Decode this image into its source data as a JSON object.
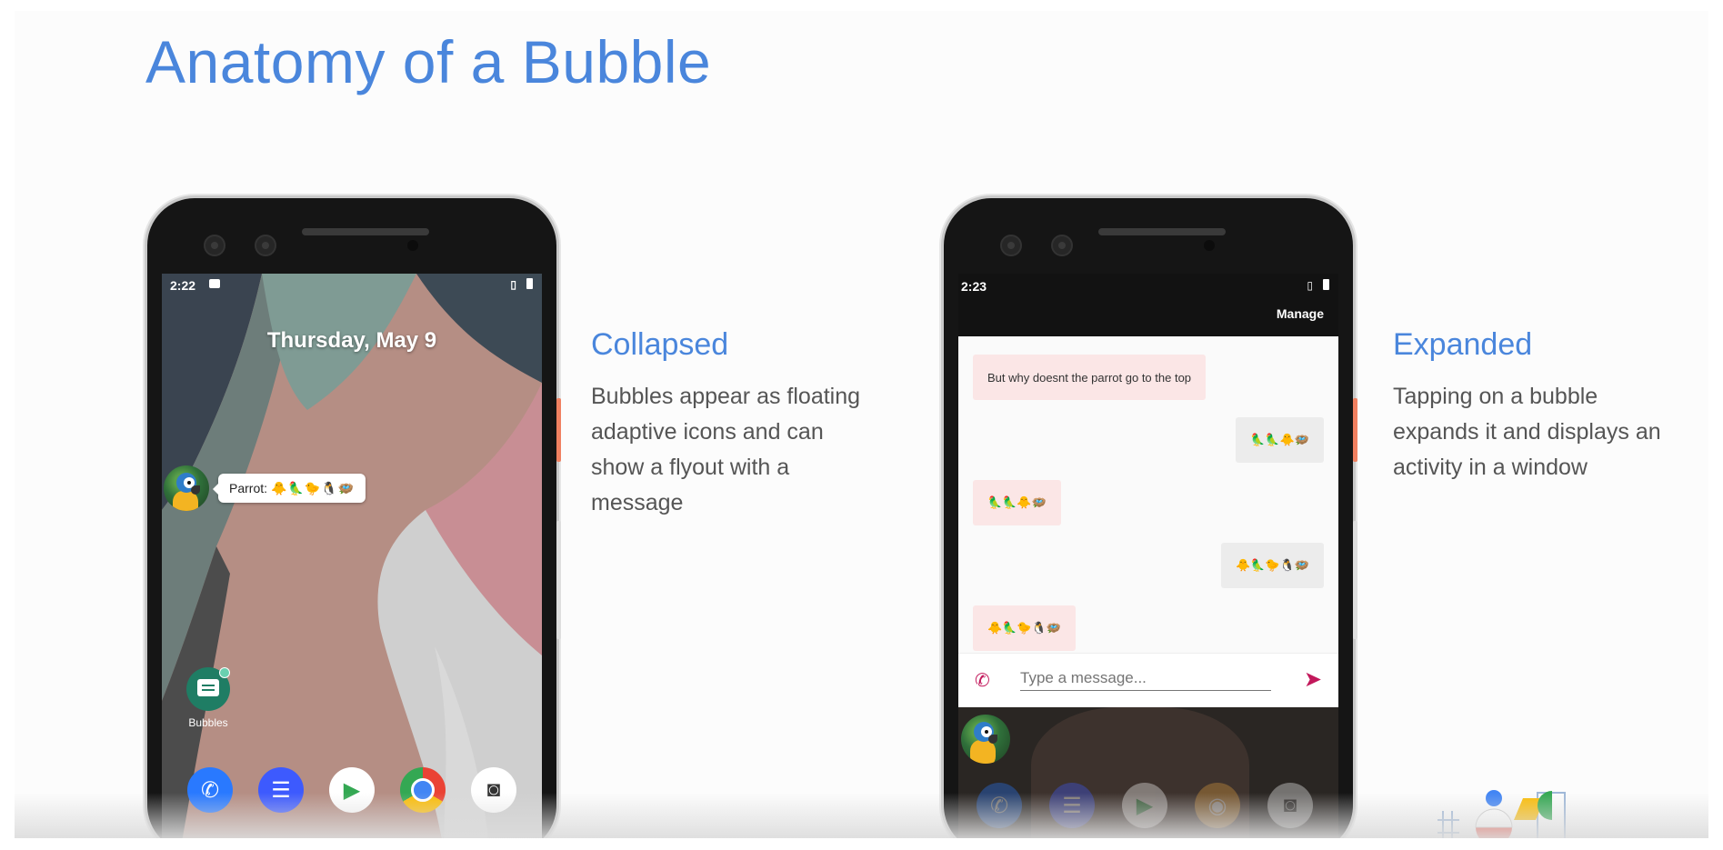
{
  "slide": {
    "title": "Anatomy of a Bubble"
  },
  "collapsed": {
    "heading": "Collapsed",
    "description": "Bubbles appear as floating adaptive icons and can show a flyout with a message"
  },
  "expanded": {
    "heading": "Expanded",
    "description": "Tapping on a bubble expands it and displays an activity in a window"
  },
  "left_phone": {
    "status_time": "2:22",
    "date": "Thursday, May 9",
    "flyout_sender": "Parrot:",
    "flyout_emojis": "🐥🦜🐤🐧🪺",
    "app_label": "Bubbles",
    "dock": [
      {
        "name": "phone-app-icon",
        "glyph": "📞",
        "color": "#2979ff"
      },
      {
        "name": "messages-app-icon",
        "glyph": "☰",
        "color": "#3d5afe"
      },
      {
        "name": "play-store-icon",
        "glyph": "▶",
        "color": "#ffffff"
      },
      {
        "name": "chrome-icon",
        "glyph": "◉",
        "color": "#ffffff"
      },
      {
        "name": "camera-app-icon",
        "glyph": "📷",
        "color": "#ffffff"
      }
    ]
  },
  "right_phone": {
    "status_time": "2:23",
    "manage_label": "Manage",
    "messages": [
      {
        "side": "in",
        "text": "But why doesnt the parrot go to the top"
      },
      {
        "side": "out",
        "text": "🦜🦜🐥🪺"
      },
      {
        "side": "in",
        "text": "🦜🦜🐥🪺"
      },
      {
        "side": "out",
        "text": "🐥🦜🐤🐧🪺"
      },
      {
        "side": "in",
        "text": "🐥🦜🐤🐧🪺"
      }
    ],
    "composer_placeholder": "Type a message..."
  },
  "colors": {
    "accent_blue": "#4a86dc",
    "body_text": "#555555",
    "incoming_bubble": "#fbe6e6",
    "outgoing_bubble": "#ececec",
    "send_accent": "#c2185b"
  },
  "icons": [
    "message-icon",
    "vibrate-icon",
    "battery-icon",
    "parrot-bubble-icon",
    "phone-icon",
    "send-icon",
    "io-logo"
  ]
}
